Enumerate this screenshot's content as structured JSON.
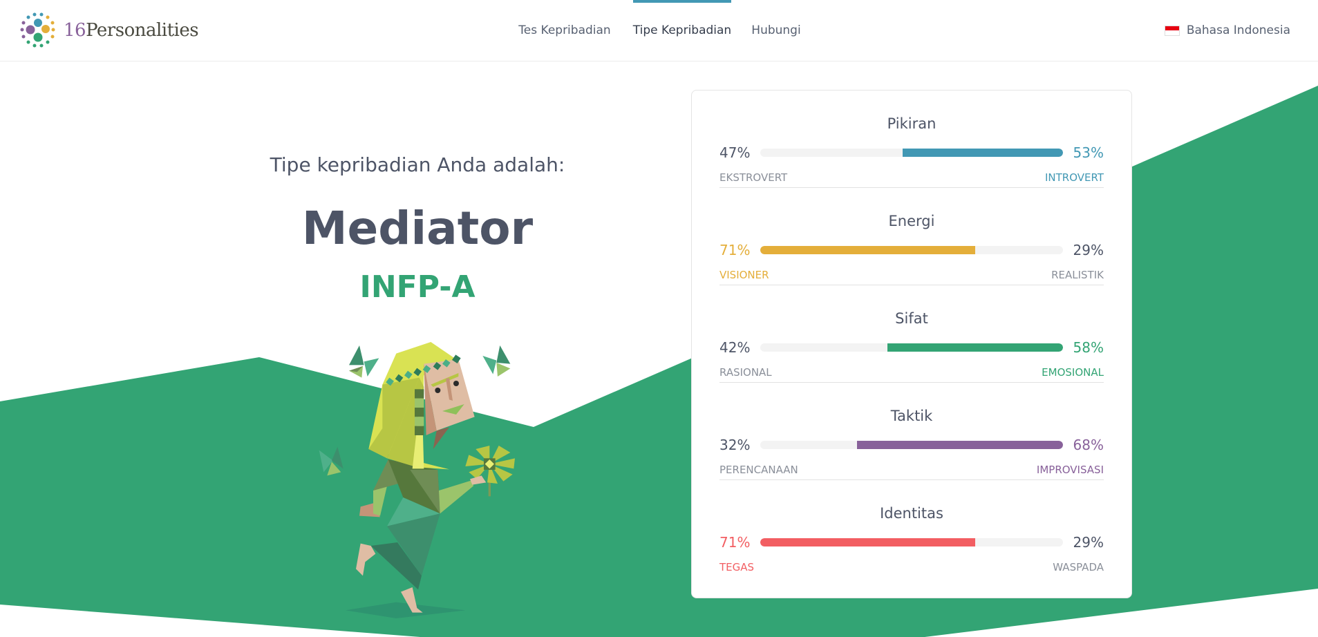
{
  "brand": {
    "number": "16",
    "name": "Personalities"
  },
  "nav": {
    "items": [
      {
        "label": "Tes Kepribadian"
      },
      {
        "label": "Tipe Kepribadian",
        "active": true
      },
      {
        "label": "Hubungi"
      }
    ]
  },
  "language": {
    "label": "Bahasa Indonesia",
    "flag_colors": [
      "#e70011",
      "#ffffff"
    ]
  },
  "result": {
    "intro": "Tipe kepribadian Anda adalah:",
    "type_name": "Mediator",
    "code": "INFP-A"
  },
  "colors": {
    "background_green": "#33a474",
    "text": "#4d5466",
    "muted": "#8a8f99",
    "track": "#f3f3f3"
  },
  "traits": [
    {
      "title": "Pikiran",
      "left_pct": "47%",
      "right_pct": "53%",
      "left_label": "Ekstrovert",
      "right_label": "Introvert",
      "value": 53,
      "dominant": "right",
      "color": "#4298b4"
    },
    {
      "title": "Energi",
      "left_pct": "71%",
      "right_pct": "29%",
      "left_label": "Visioner",
      "right_label": "Realistik",
      "value": 71,
      "dominant": "left",
      "color": "#e4ae3a"
    },
    {
      "title": "Sifat",
      "left_pct": "42%",
      "right_pct": "58%",
      "left_label": "Rasional",
      "right_label": "Emosional",
      "value": 58,
      "dominant": "right",
      "color": "#33a474"
    },
    {
      "title": "Taktik",
      "left_pct": "32%",
      "right_pct": "68%",
      "left_label": "Perencanaan",
      "right_label": "Improvisasi",
      "value": 68,
      "dominant": "right",
      "color": "#88619a"
    },
    {
      "title": "Identitas",
      "left_pct": "71%",
      "right_pct": "29%",
      "left_label": "Tegas",
      "right_label": "Waspada",
      "value": 71,
      "dominant": "left",
      "color": "#f25e62"
    }
  ]
}
